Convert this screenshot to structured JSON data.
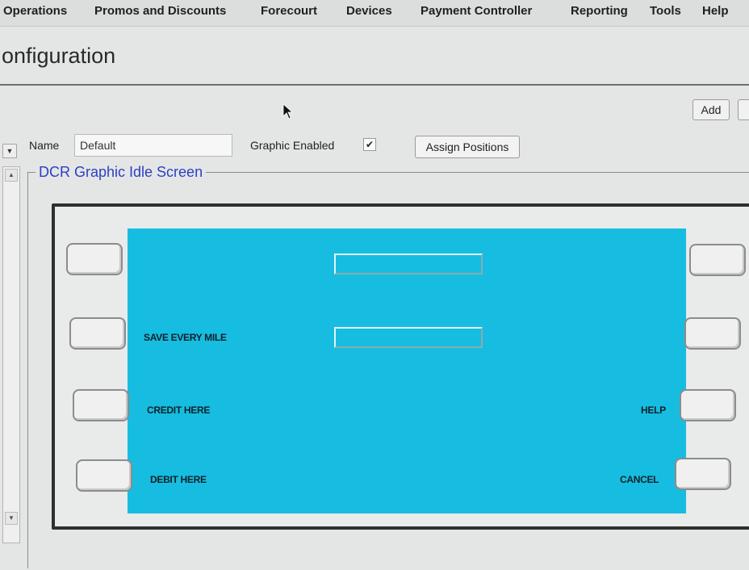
{
  "menu": {
    "items": [
      "Operations",
      "Promos and Discounts",
      "Forecourt",
      "Devices",
      "Payment Controller",
      "Reporting",
      "Tools",
      "Help"
    ]
  },
  "page": {
    "title": "onfiguration"
  },
  "toolbar": {
    "add_label": "Add"
  },
  "form": {
    "name_label": "Name",
    "name_value": "Default",
    "graphic_enabled_label": "Graphic Enabled",
    "graphic_enabled_checked": true,
    "checkbox_mark": "✔",
    "assign_positions_label": "Assign Positions"
  },
  "group": {
    "legend": "DCR Graphic Idle Screen"
  },
  "screen": {
    "background_color": "#16bde0",
    "labels": {
      "save_every_mile": "SAVE EVERY MILE",
      "credit_here": "CREDIT HERE",
      "debit_here": "DEBIT HERE",
      "help": "HELP",
      "cancel": "CANCEL"
    }
  },
  "icons": {
    "cursor": "cursor-arrow-icon",
    "dropdown": "chevron-down-icon",
    "scroll_up": "scroll-up-icon",
    "scroll_down": "scroll-down-icon"
  }
}
